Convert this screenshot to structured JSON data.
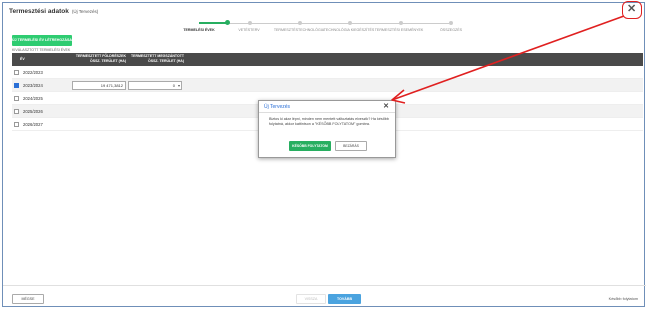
{
  "window": {
    "title": "Termesztési adatok",
    "subtitle": "(Új Tervezés)",
    "close_label": "✕"
  },
  "steps": [
    {
      "label": "TERMELÉSI ÉVEK",
      "active": true
    },
    {
      "label": "VETÉSTERV",
      "active": false
    },
    {
      "label": "TERMESZTÉSTECHNOLÓGIA",
      "active": false
    },
    {
      "label": "TECHNOLÓGIA KIEGÉSZÍTÉS",
      "active": false
    },
    {
      "label": "TERMESZTÉSI ESEMÉNYEK",
      "active": false
    },
    {
      "label": "ÖSSZEGZÉS",
      "active": false
    }
  ],
  "new_year_button": "ÚJ TERMELÉSI ÉV LÉTREHOZÁSA",
  "selected_years_label": "KIVÁLASZTOTT TERMELÉSI ÉVEK",
  "table": {
    "headers": {
      "year": "ÉV",
      "area": "TERMESZTETT FÖLDRÉSZEK ÖSSZ. TERÜLET (HA)",
      "unplanned": "TERMESZTETT MEGSZÁNTOTT ÖSSZ. TERÜLET (HA)"
    },
    "rows": [
      {
        "year": "2022/2023",
        "checked": false,
        "area": "",
        "unplanned": ""
      },
      {
        "year": "2023/2024",
        "checked": true,
        "area": "19 471,3812",
        "unplanned": "0"
      },
      {
        "year": "2024/2025",
        "checked": false,
        "area": "",
        "unplanned": ""
      },
      {
        "year": "2025/2026",
        "checked": false,
        "area": "",
        "unplanned": ""
      },
      {
        "year": "2026/2027",
        "checked": false,
        "area": "",
        "unplanned": ""
      }
    ]
  },
  "modal": {
    "title": "Új Tervezés",
    "close_label": "✕",
    "text": "Biztos ki akar lépni, minden nem mentett változtatás elveszik? Ha később folytatná, akkor kattintson a \"KÉSŐBB FOLYTATOM\" gombra.",
    "ok_label": "KÉSŐBB FOLYTATOM",
    "cancel_label": "BEZÁRÁS"
  },
  "footer": {
    "cancel_label": "MÉGSE",
    "back_label": "VISSZA",
    "next_label": "TOVÁBB",
    "save_label": "Később folytatom"
  },
  "colors": {
    "accent_green": "#27ae60",
    "primary_blue": "#4aa3df",
    "annotation_red": "#e02020"
  }
}
